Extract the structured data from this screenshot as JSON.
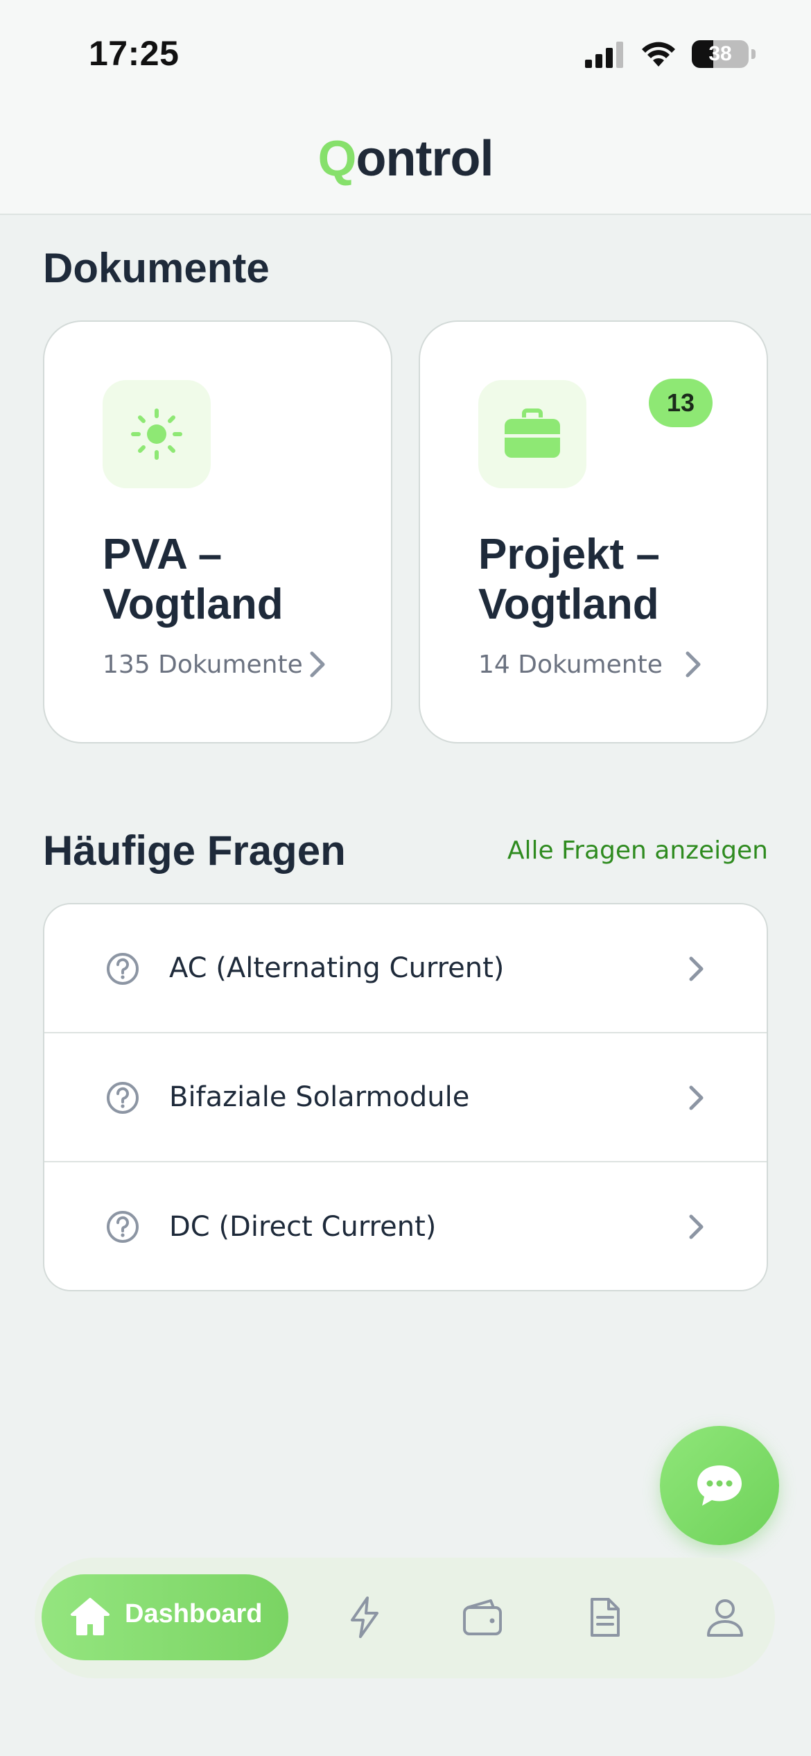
{
  "status_bar": {
    "time": "17:25",
    "battery": "38"
  },
  "header": {
    "logo_q": "Q",
    "logo_rest": "ontrol"
  },
  "documents": {
    "title": "Dokumente",
    "cards": [
      {
        "icon": "sun-icon",
        "title_line1": "PVA –",
        "title_line2": "Vogtland",
        "count": "135 Dokumente",
        "badge": ""
      },
      {
        "icon": "briefcase-icon",
        "title_line1": "Projekt –",
        "title_line2": "Vogtland",
        "count": "14 Dokumente",
        "badge": "13"
      }
    ]
  },
  "faq": {
    "title": "Häufige Fragen",
    "link": "Alle Fragen anzeigen",
    "items": [
      {
        "label": "AC (Alternating Current)"
      },
      {
        "label": "Bifaziale Solarmodule"
      },
      {
        "label": "DC (Direct Current)"
      }
    ]
  },
  "nav": {
    "active_label": "Dashboard",
    "items": [
      "home-icon",
      "lightning-icon",
      "wallet-icon",
      "document-icon",
      "user-icon"
    ]
  },
  "colors": {
    "accent": "#86e06b",
    "accent_dark": "#2e8b1f",
    "text": "#1e2a3a",
    "muted": "#6b7280",
    "background": "#eef2f1"
  }
}
